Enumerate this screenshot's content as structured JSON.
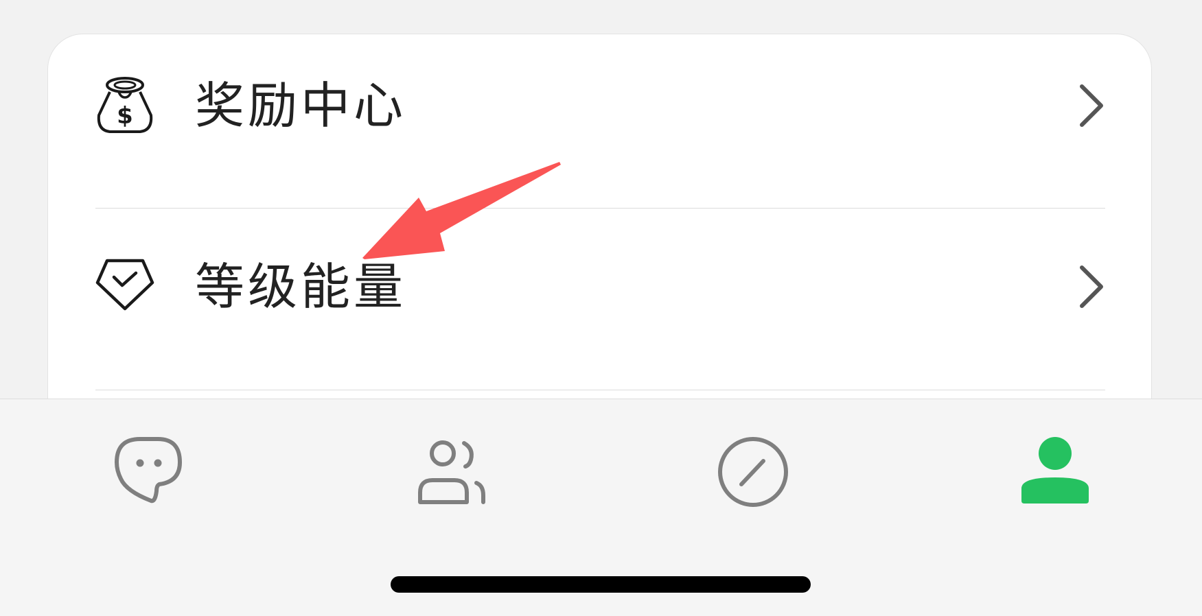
{
  "menu": {
    "items": [
      {
        "label": "奖励中心",
        "icon": "money-bag-icon"
      },
      {
        "label": "等级能量",
        "icon": "diamond-check-icon"
      }
    ]
  },
  "tabbar": {
    "tabs": [
      {
        "icon": "chat-bubble-icon",
        "active": false
      },
      {
        "icon": "contacts-icon",
        "active": false
      },
      {
        "icon": "discover-compass-icon",
        "active": false
      },
      {
        "icon": "profile-person-icon",
        "active": true
      }
    ],
    "active_color": "#25c160",
    "inactive_color": "#7f7f7f"
  },
  "annotation": {
    "arrow_color": "#fa5555"
  }
}
